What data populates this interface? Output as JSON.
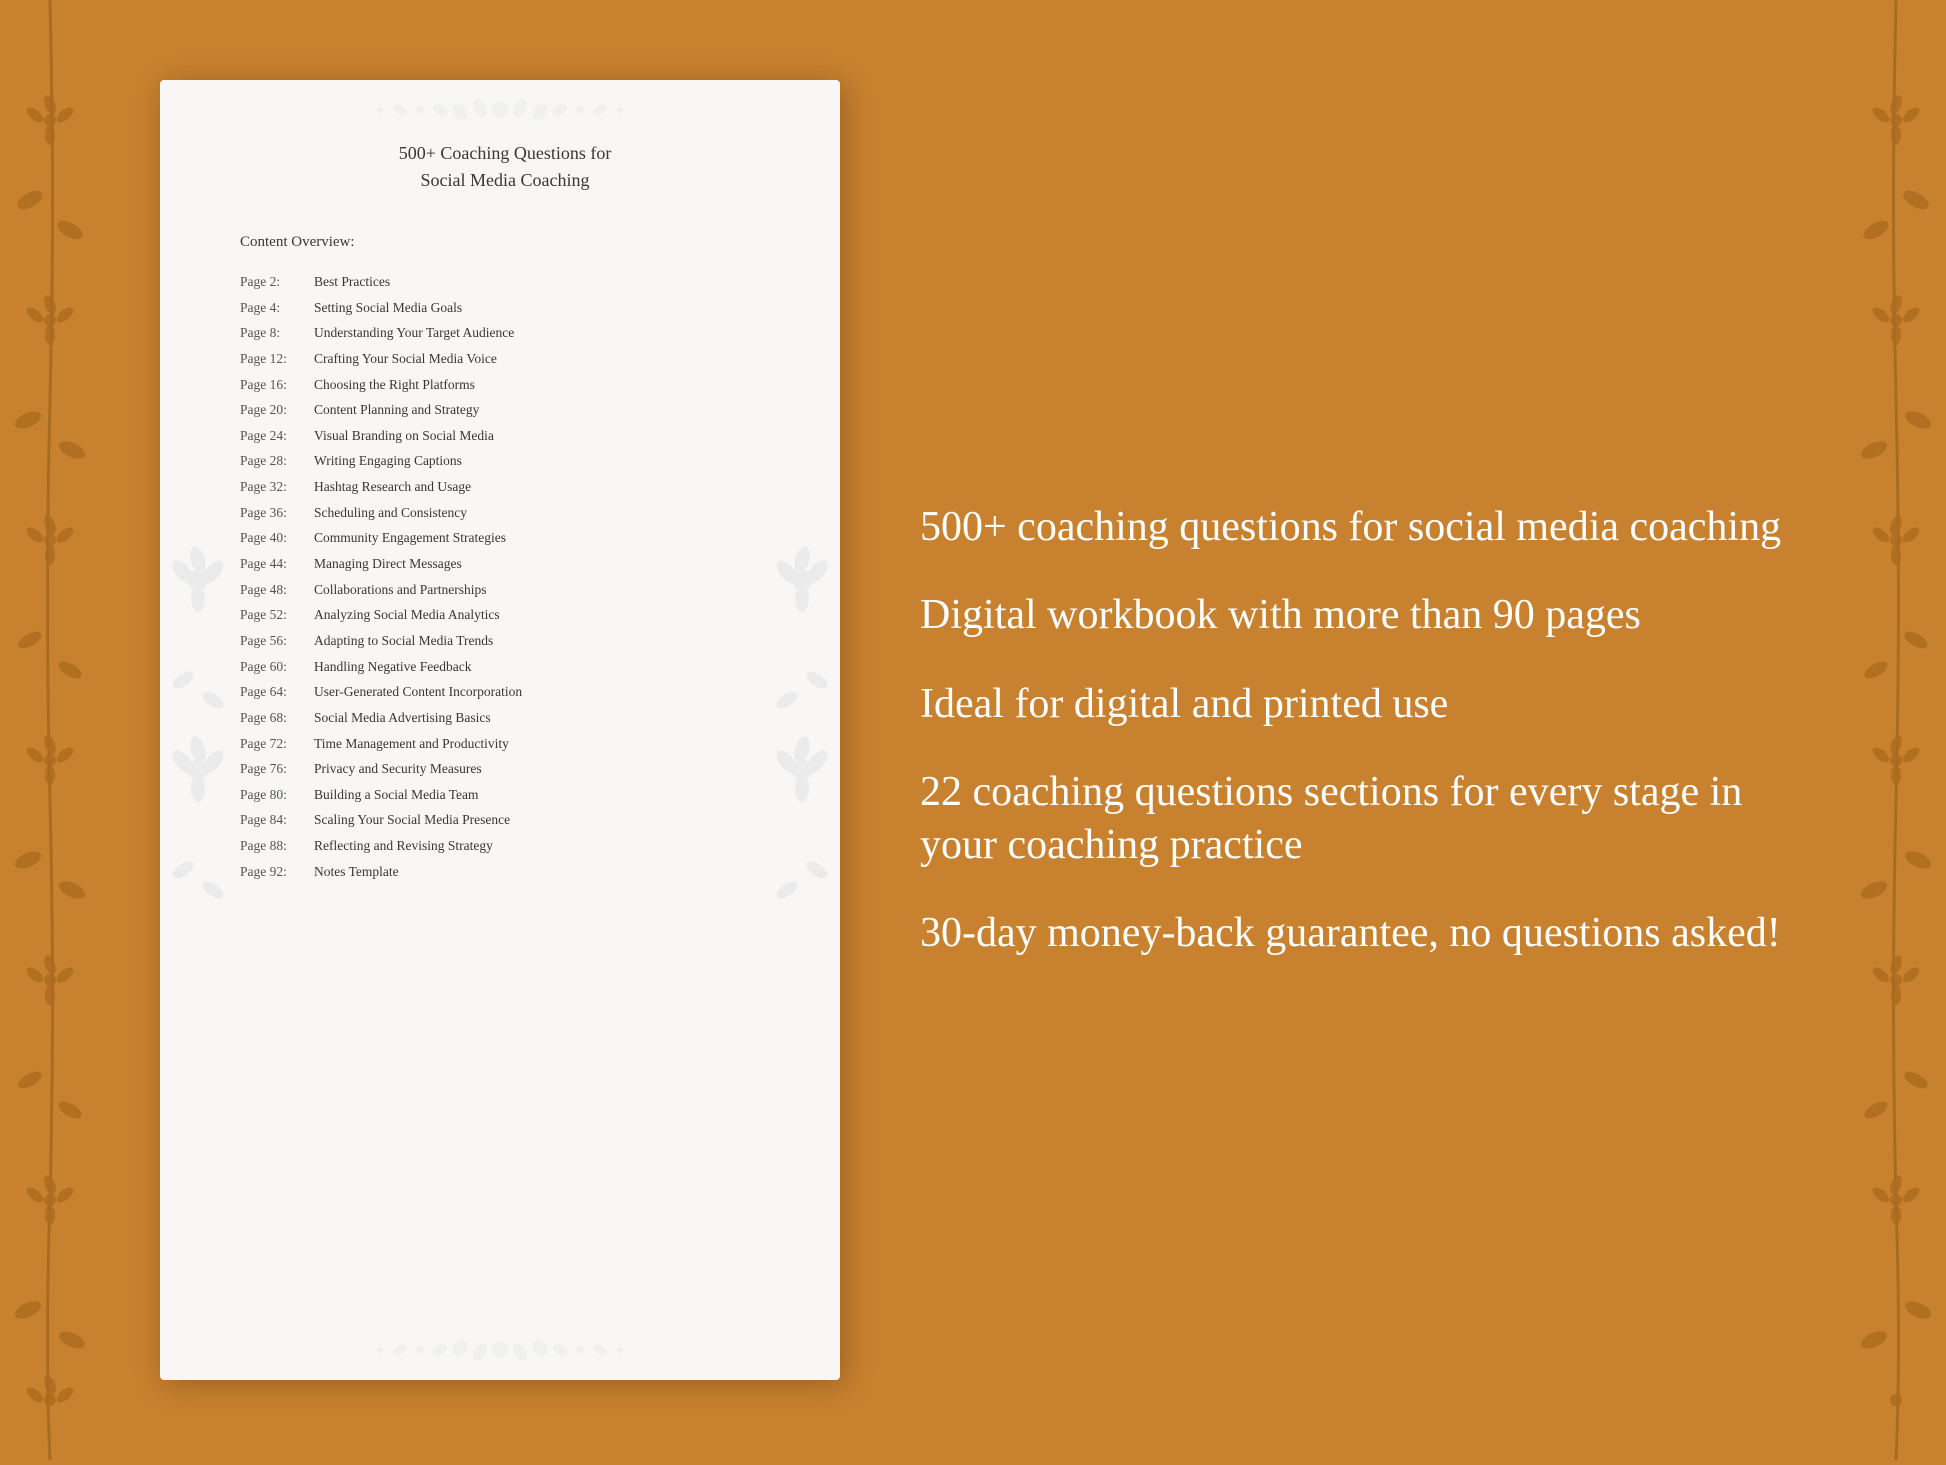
{
  "background_color": "#C8812E",
  "document": {
    "title_line1": "500+ Coaching Questions for",
    "title_line2": "Social Media Coaching",
    "content_overview_label": "Content Overview:",
    "toc": [
      {
        "page": "Page  2:",
        "title": "Best Practices"
      },
      {
        "page": "Page  4:",
        "title": "Setting Social Media Goals"
      },
      {
        "page": "Page  8:",
        "title": "Understanding Your Target Audience"
      },
      {
        "page": "Page 12:",
        "title": "Crafting Your Social Media Voice"
      },
      {
        "page": "Page 16:",
        "title": "Choosing the Right Platforms"
      },
      {
        "page": "Page 20:",
        "title": "Content Planning and Strategy"
      },
      {
        "page": "Page 24:",
        "title": "Visual Branding on Social Media"
      },
      {
        "page": "Page 28:",
        "title": "Writing Engaging Captions"
      },
      {
        "page": "Page 32:",
        "title": "Hashtag Research and Usage"
      },
      {
        "page": "Page 36:",
        "title": "Scheduling and Consistency"
      },
      {
        "page": "Page 40:",
        "title": "Community Engagement Strategies"
      },
      {
        "page": "Page 44:",
        "title": "Managing Direct Messages"
      },
      {
        "page": "Page 48:",
        "title": "Collaborations and Partnerships"
      },
      {
        "page": "Page 52:",
        "title": "Analyzing Social Media Analytics"
      },
      {
        "page": "Page 56:",
        "title": "Adapting to Social Media Trends"
      },
      {
        "page": "Page 60:",
        "title": "Handling Negative Feedback"
      },
      {
        "page": "Page 64:",
        "title": "User-Generated Content Incorporation"
      },
      {
        "page": "Page 68:",
        "title": "Social Media Advertising Basics"
      },
      {
        "page": "Page 72:",
        "title": "Time Management and Productivity"
      },
      {
        "page": "Page 76:",
        "title": "Privacy and Security Measures"
      },
      {
        "page": "Page 80:",
        "title": "Building a Social Media Team"
      },
      {
        "page": "Page 84:",
        "title": "Scaling Your Social Media Presence"
      },
      {
        "page": "Page 88:",
        "title": "Reflecting and Revising Strategy"
      },
      {
        "page": "Page 92:",
        "title": "Notes Template"
      }
    ]
  },
  "features": [
    "500+ coaching questions for social media coaching",
    "Digital workbook with more than 90 pages",
    "Ideal for digital and printed use",
    "22 coaching questions sections for every stage in your coaching practice",
    "30-day money-back guarantee, no questions asked!"
  ]
}
